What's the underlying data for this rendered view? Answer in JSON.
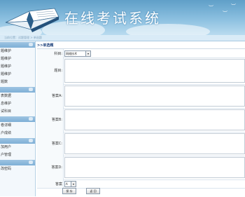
{
  "header": {
    "title": "在线考试系统"
  },
  "breadcrumb": {
    "text": "当前位置：试题管理 > 单选题"
  },
  "sidebar": {
    "groups": [
      {
        "items": [
          "题维护",
          "题维护",
          "题维护",
          "题维护",
          "题数"
        ]
      },
      {
        "items": [
          "表数据",
          "息维护",
          "试科目"
        ]
      },
      {
        "items": [
          "卷详细",
          "户成绩"
        ]
      },
      {
        "items": [
          "加用户",
          "户管理"
        ]
      },
      {
        "items": [
          "改密码"
        ]
      }
    ]
  },
  "main": {
    "title": ">>单选题",
    "subject_label": "科目:",
    "subject_value": "网络技术",
    "question_label": "题目:",
    "option_a_label": "答案A:",
    "option_b_label": "答案B:",
    "option_c_label": "答案C:",
    "option_d_label": "答案D:",
    "answer_label": "答案",
    "answer_value": "A",
    "save_label": "保 存",
    "back_label": "返 回"
  }
}
